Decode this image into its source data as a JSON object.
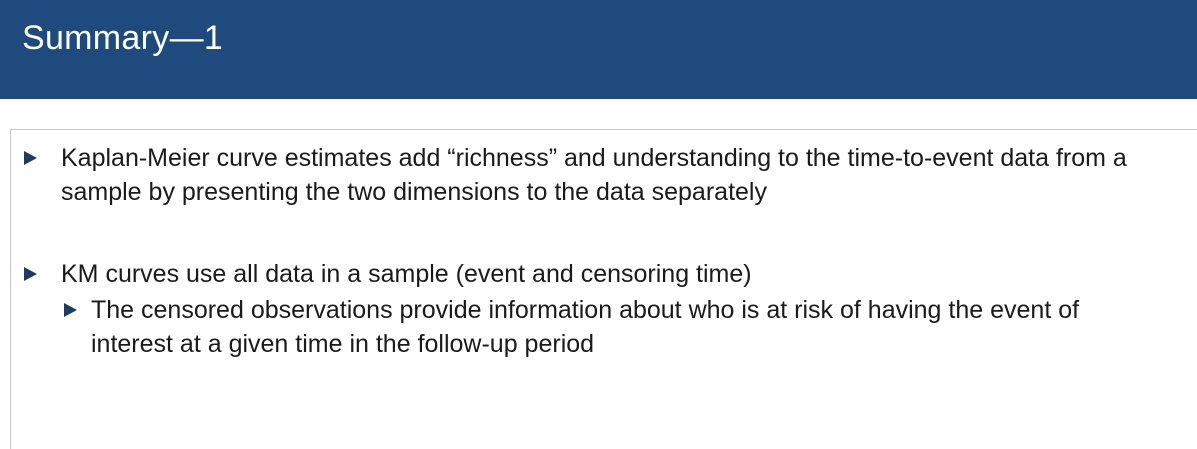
{
  "slide": {
    "title": "Summary—1",
    "bullets": [
      {
        "level": 1,
        "text": "Kaplan-Meier curve estimates add “richness” and understanding to the time-to-event data from a sample by presenting the two dimensions to the data separately"
      },
      {
        "level": 1,
        "text": "KM curves use all data in a sample (event and censoring time)"
      },
      {
        "level": 2,
        "text": "The censored observations provide information about who is at risk of having the event of interest at a given time in the follow-up period"
      }
    ]
  },
  "colors": {
    "title_bar": "#1f4a7e",
    "bullet_marker": "#1f3a63"
  },
  "icons": {
    "bullet_marker": "triangle-right-icon"
  }
}
